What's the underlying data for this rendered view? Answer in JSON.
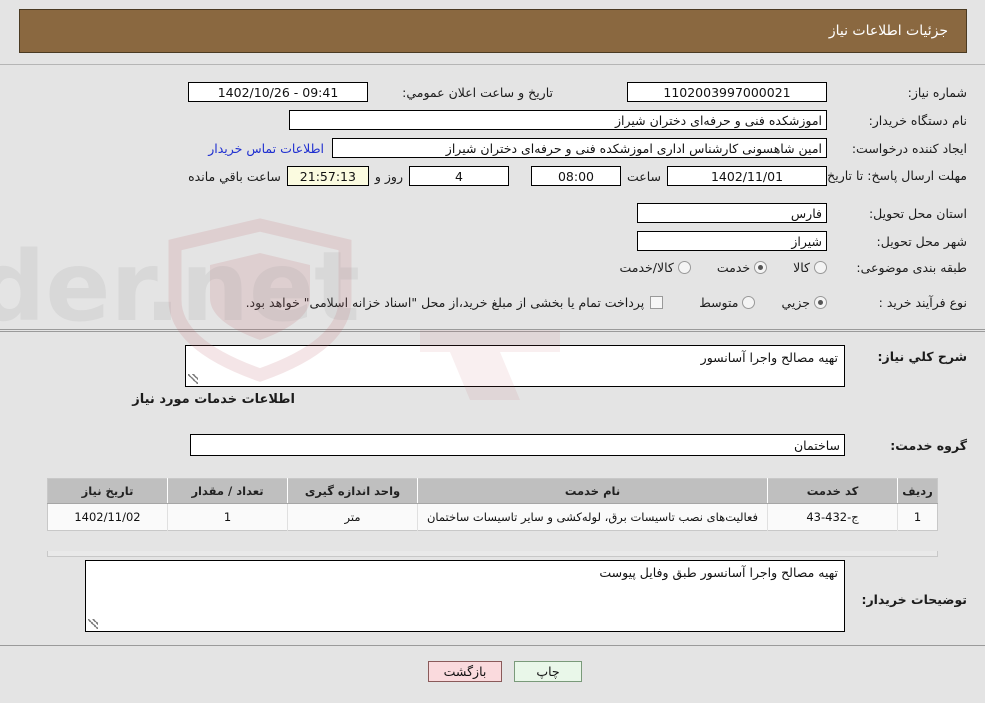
{
  "header": {
    "title": "جزئیات اطلاعات نیاز"
  },
  "form": {
    "need_number_label": "شماره نیاز:",
    "need_number_value": "1102003997000021",
    "announce_datetime_label": "تاریخ و ساعت اعلان عمومي:",
    "announce_datetime_value": "09:41 - 1402/10/26",
    "buyer_org_label": "نام دستگاه خریدار:",
    "buyer_org_value": "اموزشکده فنی و حرفه‌ای دختران شیراز",
    "creator_label": "ایجاد کننده درخواست:",
    "creator_value": "امین شاهسونی کارشناس اداری اموزشکده فنی و حرفه‌ای دختران شیراز",
    "contact_link": "اطلاعات تماس خریدار",
    "deadline_label": "مهلت ارسال پاسخ: تا تاریخ:",
    "deadline_date_value": "1402/11/01",
    "deadline_hour_label": "ساعت",
    "deadline_hour_value": "08:00",
    "remaining_days_value": "4",
    "remaining_days_label": "روز و",
    "remaining_time_value": "21:57:13",
    "remaining_time_label": "ساعت باقي مانده",
    "province_label": "استان محل تحویل:",
    "province_value": "فارس",
    "city_label": "شهر محل تحویل:",
    "city_value": "شیراز",
    "category_label": "طبقه بندی موضوعی:",
    "category_options": [
      {
        "label": "کالا",
        "selected": false
      },
      {
        "label": "خدمت",
        "selected": true
      },
      {
        "label": "کالا/خدمت",
        "selected": false
      }
    ],
    "process_label": "نوع فرآیند خرید :",
    "process_options": [
      {
        "label": "جزیي",
        "selected": true
      },
      {
        "label": "متوسط",
        "selected": false
      }
    ],
    "treasury_checkbox_checked": false,
    "treasury_text": "پرداخت تمام یا بخشی از مبلغ خرید،از محل \"اسناد خزانه اسلامی\" خواهد بود."
  },
  "need_description": {
    "label": "شرح کلي نیاز:",
    "value": "تهیه مصالح واجرا آسانسور"
  },
  "services_section": {
    "heading": "اطلاعات خدمات مورد نیاز",
    "group_label": "گروه خدمت:",
    "group_value": "ساختمان"
  },
  "table": {
    "columns": [
      "ردیف",
      "کد خدمت",
      "نام خدمت",
      "واحد اندازه گیری",
      "تعداد / مقدار",
      "تاریخ نیاز"
    ],
    "rows": [
      {
        "row_no": "1",
        "service_code": "ج-432-43",
        "service_name": "فعالیت‌های نصب تاسیسات برق، لوله‌کشی و سایر تاسیسات ساختمان",
        "unit": "متر",
        "quantity": "1",
        "need_date": "1402/11/02"
      }
    ]
  },
  "buyer_remarks": {
    "label": "توضیحات خریدار:",
    "value": "تهیه مصالح واجرا آسانسور طبق وفایل پیوست"
  },
  "footer": {
    "print_button": "چاپ",
    "back_button": "بازگشت"
  },
  "watermark": {
    "text": "AriaTender.net"
  },
  "colors": {
    "header_bg": "#8a6840",
    "page_bg": "#e4e4e4",
    "link": "#1f2fd0",
    "table_header_bg": "#bfbfbf",
    "print_button_bg": "#e9f7e9",
    "back_button_bg": "#fadadd",
    "countdown_bg": "#fbfbe0"
  }
}
